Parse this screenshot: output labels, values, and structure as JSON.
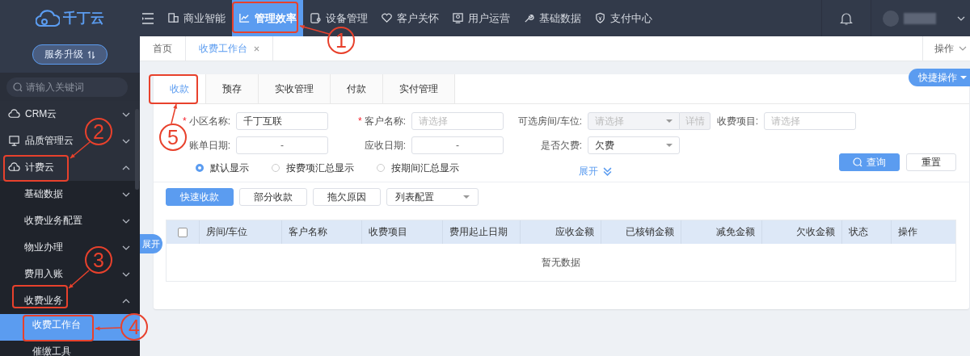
{
  "logo": {
    "text": "千丁云"
  },
  "upgrade_button": {
    "label": "服务升级"
  },
  "nav": [
    {
      "label": "商业智能",
      "selected": false
    },
    {
      "label": "管理效率",
      "selected": true
    },
    {
      "label": "设备管理",
      "selected": false
    },
    {
      "label": "客户关怀",
      "selected": false
    },
    {
      "label": "用户运营",
      "selected": false
    },
    {
      "label": "基础数据",
      "selected": false
    },
    {
      "label": "支付中心",
      "selected": false
    }
  ],
  "search": {
    "placeholder": "请输入关键词"
  },
  "sidebar": {
    "items": [
      {
        "label": "CRM云",
        "expanded": false,
        "selected": false
      },
      {
        "label": "品质管理云",
        "expanded": false,
        "selected": false
      },
      {
        "label": "计费云",
        "expanded": true,
        "selected": false,
        "children": [
          {
            "label": "基础数据",
            "expanded": false,
            "selected": false
          },
          {
            "label": "收费业务配置",
            "expanded": false,
            "selected": false
          },
          {
            "label": "物业办理",
            "expanded": false,
            "selected": false
          },
          {
            "label": "费用入账",
            "expanded": false,
            "selected": false
          },
          {
            "label": "收费业务",
            "expanded": true,
            "selected": false,
            "children": [
              {
                "label": "收费工作台",
                "selected": true
              },
              {
                "label": "催缴工具",
                "selected": false
              }
            ]
          }
        ]
      }
    ]
  },
  "page_tabs": [
    {
      "label": "首页",
      "selected": false,
      "closable": false
    },
    {
      "label": "收费工作台",
      "selected": true,
      "closable": true
    }
  ],
  "actions_menu": {
    "label": "操作"
  },
  "quick_actions": {
    "label": "快捷操作"
  },
  "card_tabs": [
    {
      "label": "收款",
      "selected": true
    },
    {
      "label": "预存",
      "selected": false
    },
    {
      "label": "实收管理",
      "selected": false
    },
    {
      "label": "付款",
      "selected": false
    },
    {
      "label": "实付管理",
      "selected": false
    }
  ],
  "filters": [
    {
      "label": "小区名称:",
      "mark": "*",
      "kind": "text",
      "value": "千丁互联"
    },
    {
      "label": "客户名称:",
      "mark": "*",
      "kind": "text",
      "placeholder": "请选择"
    },
    {
      "label": "可选房间/车位:",
      "kind": "select",
      "placeholder": "请选择",
      "disabled": true,
      "detail": "详情"
    },
    {
      "label": "收费项目:",
      "kind": "text",
      "placeholder": "请选择"
    },
    {
      "label": "账单日期:",
      "kind": "date-range",
      "separator": "-"
    },
    {
      "label": "应收日期:",
      "kind": "date-range",
      "separator": "-"
    },
    {
      "label": "是否欠费:",
      "kind": "select",
      "value": "欠费",
      "disabled": false
    }
  ],
  "display_modes": [
    {
      "label": "默认显示",
      "selected": true
    },
    {
      "label": "按费项汇总显示",
      "selected": false
    },
    {
      "label": "按期间汇总显示",
      "selected": false
    }
  ],
  "expand_link": {
    "label": "展开"
  },
  "query_button": {
    "label": "查询"
  },
  "reset_button": {
    "label": "重置"
  },
  "action_buttons": [
    {
      "label": "快速收款",
      "primary": true
    },
    {
      "label": "部分收款",
      "primary": false
    },
    {
      "label": "拖欠原因",
      "primary": false
    }
  ],
  "column_config": {
    "label": "列表配置"
  },
  "table": {
    "columns": [
      {
        "label": "房间/车位",
        "kind": "text"
      },
      {
        "label": "客户名称",
        "kind": "text"
      },
      {
        "label": "收费项目",
        "kind": "text"
      },
      {
        "label": "费用起止日期",
        "kind": "text"
      },
      {
        "label": "应收金额",
        "kind": "amount"
      },
      {
        "label": "已核销金额",
        "kind": "amount"
      },
      {
        "label": "减免金额",
        "kind": "amount"
      },
      {
        "label": "欠收金额",
        "kind": "amount"
      },
      {
        "label": "状态",
        "kind": "text"
      },
      {
        "label": "操作",
        "kind": "text"
      }
    ],
    "select_all": {
      "checked": false
    },
    "empty_text": "暂无数据"
  },
  "side_toggle": {
    "label": "展开"
  },
  "annotations": [
    {
      "label": "1"
    },
    {
      "label": "2"
    },
    {
      "label": "3"
    },
    {
      "label": "4"
    },
    {
      "label": "5"
    }
  ]
}
